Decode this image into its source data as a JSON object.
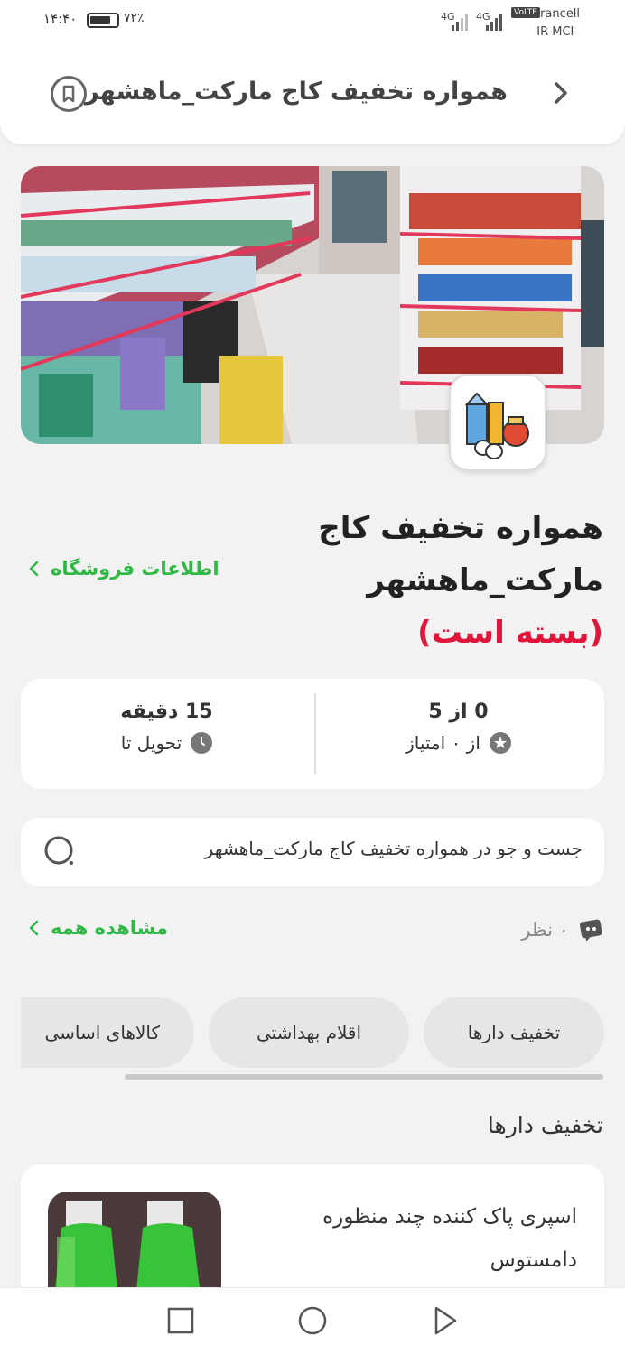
{
  "status_bar": {
    "time": "۱۴:۴۰",
    "battery": "۷۲٪",
    "network_1": "4G",
    "network_2": "4G",
    "volte": "VoLTE",
    "carrier_1": "Irancell",
    "carrier_2": "IR-MCI"
  },
  "header": {
    "title": "همواره تخفیف کاج مارکت_ماهشهر"
  },
  "store": {
    "name_line1": "همواره تخفیف کاج",
    "name_line2": "مارکت_ماهشهر",
    "closed_status": "(بسته است)",
    "info_link": "اطلاعات فروشگاه"
  },
  "stats": {
    "rating_value": "0 از 5",
    "rating_label": "از ۰ امتیاز",
    "delivery_value": "15 دقیقه",
    "delivery_label": "تحویل تا"
  },
  "search": {
    "placeholder": "جست و جو در همواره تخفیف کاج مارکت_ماهشهر"
  },
  "reviews": {
    "count_label": "۰ نظر",
    "see_all": "مشاهده همه"
  },
  "categories": [
    {
      "label": "تخفیف دارها"
    },
    {
      "label": "اقلام بهداشتی"
    },
    {
      "label": "کالاهای اساسی"
    }
  ],
  "section": {
    "title": "تخفیف دارها"
  },
  "product": {
    "name": "اسپری پاک کننده چند منظوره دامستوس"
  },
  "colors": {
    "accent_green": "#2fb844",
    "closed_red": "#e0153a"
  }
}
